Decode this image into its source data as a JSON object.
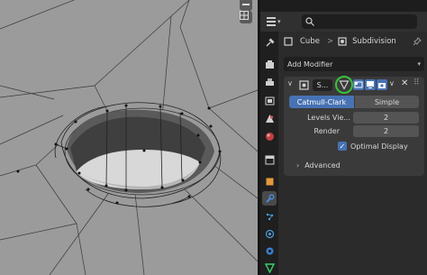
{
  "header": {
    "editor_type_icon": "properties-icon",
    "search_placeholder": ""
  },
  "tabs": [
    {
      "name": "tool-tab",
      "icon": "wrench-screwdriver-icon",
      "active": false
    },
    {
      "name": "render-tab",
      "icon": "camera-back-icon",
      "active": false
    },
    {
      "name": "output-tab",
      "icon": "printer-icon",
      "active": false
    },
    {
      "name": "view-layer-tab",
      "icon": "image-stack-icon",
      "active": false
    },
    {
      "name": "scene-tab",
      "icon": "scene-cone-icon",
      "active": false
    },
    {
      "name": "world-tab",
      "icon": "world-globe-icon",
      "active": false
    },
    {
      "name": "collection-tab",
      "icon": "collection-box-icon",
      "active": false
    },
    {
      "name": "object-tab",
      "icon": "object-square-icon",
      "active": false
    },
    {
      "name": "modifier-tab",
      "icon": "wrench-icon",
      "active": true
    },
    {
      "name": "particles-tab",
      "icon": "particles-icon",
      "active": false
    },
    {
      "name": "physics-tab",
      "icon": "physics-orbit-icon",
      "active": false
    },
    {
      "name": "constraints-tab",
      "icon": "constraint-icon",
      "active": false
    },
    {
      "name": "data-tab",
      "icon": "mesh-triangle-icon",
      "active": false
    }
  ],
  "breadcrumb": {
    "object": "Cube",
    "separator": ">",
    "modifier": "Subdivision"
  },
  "add_modifier": {
    "label": "Add Modifier"
  },
  "modifier": {
    "name_short": "S...",
    "algorithm_options": [
      "Catmull-Clark",
      "Simple"
    ],
    "selected_algorithm": "Catmull-Clark",
    "levels_viewport_label": "Levels Vie...",
    "levels_viewport_value": "2",
    "render_label": "Render",
    "render_value": "2",
    "optimal_display_label": "Optimal Display",
    "optimal_display_checked": true,
    "advanced_label": "Advanced"
  },
  "colors": {
    "accent_blue": "#4772b3",
    "highlight_circle": "#39c23a",
    "viewport_gray": "#9b9b9b"
  }
}
